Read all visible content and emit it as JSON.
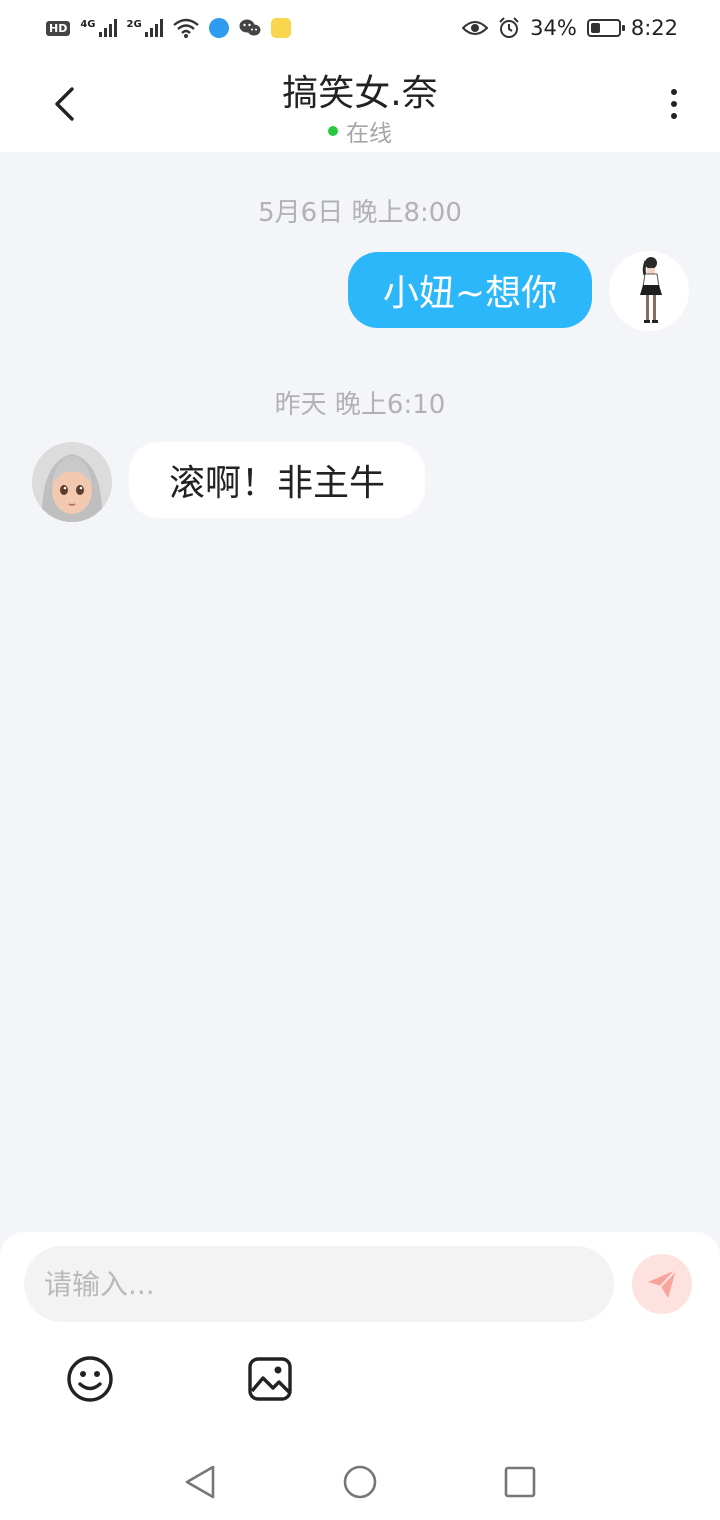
{
  "status_bar": {
    "hd": "HD",
    "net1": "4G",
    "net2": "2G",
    "battery_percent": "34%",
    "battery_level": 0.34,
    "time": "8:22"
  },
  "header": {
    "title": "搞笑女.奈",
    "online_status": "在线",
    "online_color": "#27c93f"
  },
  "messages": [
    {
      "timestamp": "5月6日 晚上8:00",
      "sender": "me",
      "text": "小妞~想你"
    },
    {
      "timestamp": "昨天 晚上6:10",
      "sender": "other",
      "text": "滚啊！非主牛"
    }
  ],
  "composer": {
    "placeholder": "请输入...",
    "send_icon": "send-icon",
    "tools": [
      "emoji-icon",
      "image-icon"
    ]
  },
  "colors": {
    "my_bubble": "#2cb7fb",
    "background": "#f4f5f8",
    "send_button_bg": "#fde2e0",
    "send_button_icon": "#f8a39b"
  }
}
